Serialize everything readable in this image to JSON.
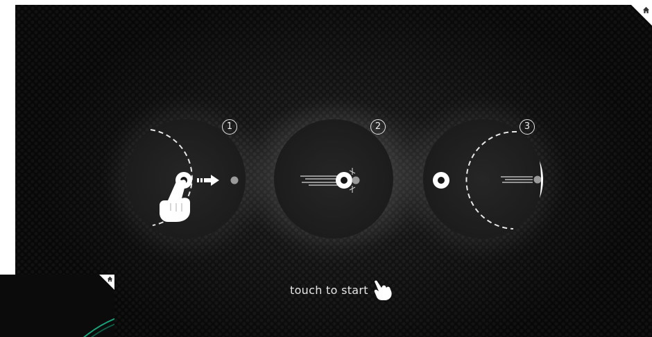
{
  "game": {
    "touch_prompt": "touch to start",
    "steps": [
      {
        "number": "1"
      },
      {
        "number": "2"
      },
      {
        "number": "3"
      }
    ]
  },
  "colors": {
    "background": "#151515",
    "foreground": "#ffffff",
    "ball_gray": "#9a9a9a",
    "thumbnail_arc": "#1aa37a"
  },
  "icons": {
    "home": "home-icon",
    "hand": "hand-pointer-icon",
    "arrow": "arrow-right-icon"
  }
}
